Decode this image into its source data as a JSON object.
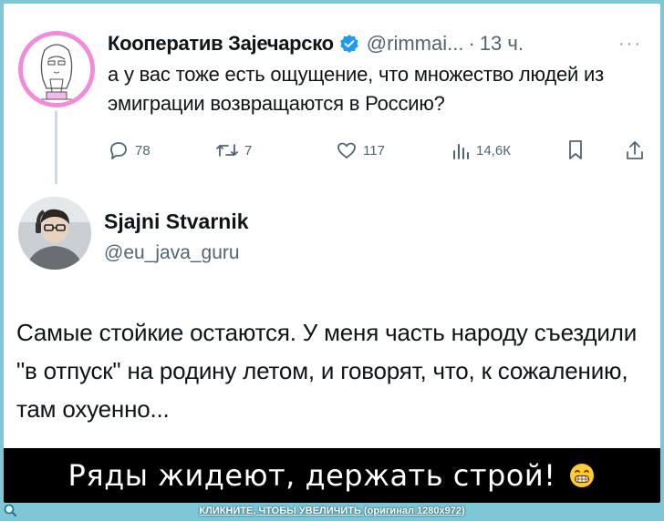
{
  "quoted_tweet": {
    "display_name": "Кооператив Зајечарско",
    "handle": "@rimmai...",
    "separator": "·",
    "time": "13 ч.",
    "more": "···",
    "text": "а у вас тоже есть ощущение, что множество людей из эмиграции возвращаются в Россию?",
    "counts": {
      "replies": "78",
      "reposts": "7",
      "likes": "117",
      "views": "14,6К"
    }
  },
  "main_tweet": {
    "display_name": "Sjajni Stvarnik",
    "handle": "@eu_java_guru",
    "text": "Самые стойкие остаются. У меня часть народу съездили \"в отпуск\" на родину летом, и говорят, что, к сожалению, там охуенно..."
  },
  "caption": {
    "text": "Ряды жидеют, держать строй!"
  },
  "bottom_bar": {
    "text": "КЛИКНИТЕ, ЧТОБЫ УВЕЛИЧИТЬ (оригинал 1280x972)"
  },
  "colors": {
    "background": "#7fc6d6",
    "avatar_ring": "#f28bd8",
    "verified": "#1d9bf0",
    "secondary_text": "#536471"
  }
}
